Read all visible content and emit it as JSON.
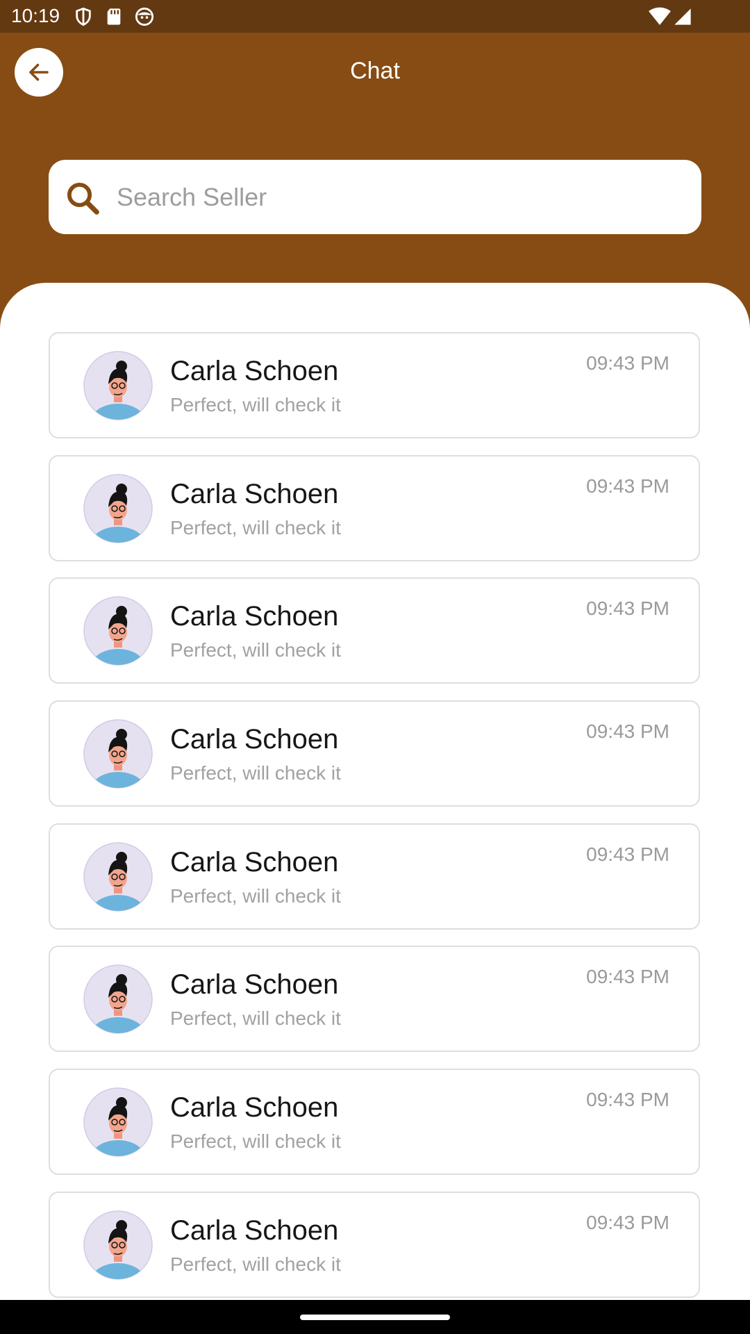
{
  "status_bar": {
    "time": "10:19",
    "icons": [
      "shield-icon",
      "sd-card-icon",
      "face-icon",
      "wifi-icon",
      "signal-icon"
    ]
  },
  "header": {
    "title": "Chat",
    "back_icon": "arrow-left-icon"
  },
  "search": {
    "placeholder": "Search Seller",
    "value": "",
    "icon": "search-icon"
  },
  "chats": [
    {
      "name": "Carla Schoen",
      "message": "Perfect, will check it",
      "time": "09:43 PM",
      "avatar": "avatar-illustration"
    },
    {
      "name": "Carla Schoen",
      "message": "Perfect, will check it",
      "time": "09:43 PM",
      "avatar": "avatar-illustration"
    },
    {
      "name": "Carla Schoen",
      "message": "Perfect, will check it",
      "time": "09:43 PM",
      "avatar": "avatar-illustration"
    },
    {
      "name": "Carla Schoen",
      "message": "Perfect, will check it",
      "time": "09:43 PM",
      "avatar": "avatar-illustration"
    },
    {
      "name": "Carla Schoen",
      "message": "Perfect, will check it",
      "time": "09:43 PM",
      "avatar": "avatar-illustration"
    },
    {
      "name": "Carla Schoen",
      "message": "Perfect, will check it",
      "time": "09:43 PM",
      "avatar": "avatar-illustration"
    },
    {
      "name": "Carla Schoen",
      "message": "Perfect, will check it",
      "time": "09:43 PM",
      "avatar": "avatar-illustration"
    },
    {
      "name": "Carla Schoen",
      "message": "Perfect, will check it",
      "time": "09:43 PM",
      "avatar": "avatar-illustration"
    }
  ],
  "colors": {
    "header_background": "#874c13",
    "status_bar_background": "#633912",
    "accent": "#874c13",
    "card_border": "#dedede",
    "secondary_text": "#a1a1a1"
  }
}
